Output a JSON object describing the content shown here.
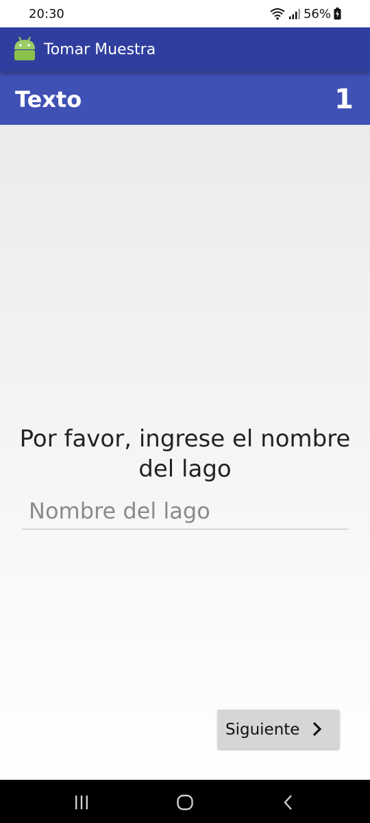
{
  "status_bar": {
    "time": "20:30",
    "battery": "56%",
    "icons": [
      "wifi-icon",
      "signal-icon",
      "battery-charging-icon"
    ]
  },
  "app_bar": {
    "title": "Tomar Muestra",
    "icon": "android-icon",
    "color": "#303f9f"
  },
  "section": {
    "title": "Texto",
    "number": "1",
    "color": "#3f51b5"
  },
  "form": {
    "prompt": "Por favor, ingrese el nombre del lago",
    "input_value": "",
    "input_placeholder": "Nombre del lago"
  },
  "next_button": {
    "label": "Siguiente",
    "icon": "chevron-right-icon"
  },
  "nav_bar": {
    "icons": [
      "recent-apps-icon",
      "home-icon",
      "back-icon"
    ]
  }
}
